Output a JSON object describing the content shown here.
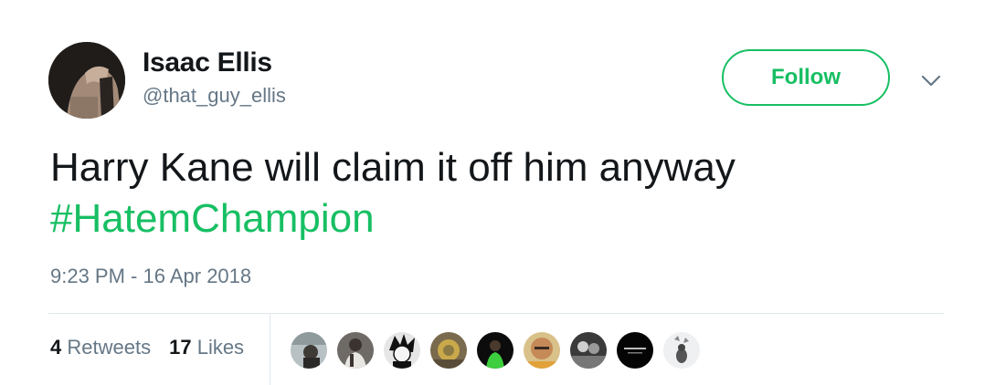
{
  "author": {
    "name": "Isaac Ellis",
    "handle": "@that_guy_ellis"
  },
  "follow_button": {
    "label": "Follow"
  },
  "tweet": {
    "text": "Harry Kane will claim it off him anyway",
    "hashtag": "#HatemChampion",
    "timestamp": "9:23 PM - 16 Apr 2018"
  },
  "stats": {
    "retweets_count": "4",
    "retweets_label": "Retweets",
    "likes_count": "17",
    "likes_label": "Likes"
  },
  "colors": {
    "accent": "#17bf63",
    "text": "#14171a",
    "secondary": "#657786",
    "border": "#e1e8ed"
  },
  "icons": {
    "more": "chevron-down-icon"
  }
}
